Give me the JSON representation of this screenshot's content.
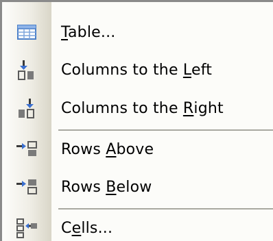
{
  "menu": {
    "items": [
      {
        "pre": "",
        "accel": "T",
        "post": "able...",
        "icon": "insert-table-icon"
      },
      {
        "pre": "Columns to the ",
        "accel": "L",
        "post": "eft",
        "icon": "insert-column-left-icon"
      },
      {
        "pre": "Columns to the ",
        "accel": "R",
        "post": "ight",
        "icon": "insert-column-right-icon"
      },
      {
        "pre": "Rows ",
        "accel": "A",
        "post": "bove",
        "icon": "insert-row-above-icon"
      },
      {
        "pre": "Rows ",
        "accel": "B",
        "post": "elow",
        "icon": "insert-row-below-icon"
      },
      {
        "pre": "C",
        "accel": "e",
        "post": "lls...",
        "icon": "insert-cells-icon"
      }
    ]
  }
}
